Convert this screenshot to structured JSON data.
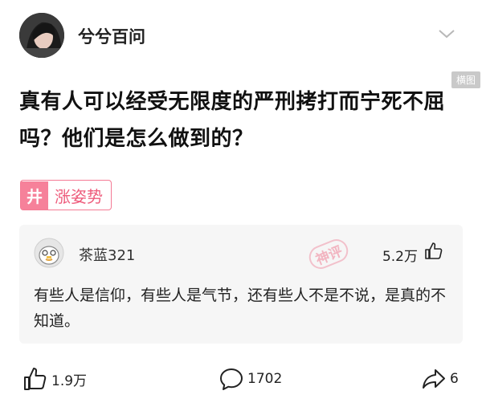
{
  "header": {
    "author_name": "兮兮百问",
    "image_badge": "横图"
  },
  "question": {
    "title": "真有人可以经受无限度的严刑拷打而宁死不屈吗？他们是怎么做到的？"
  },
  "tag": {
    "icon_glyph": "井",
    "label": "涨姿势"
  },
  "answer": {
    "user_name": "茶蓝321",
    "likes": "5.2万",
    "text": "有些人是信仰，有些人是气节，还有些人不是不说，是真的不知道。",
    "watermark": "神评"
  },
  "footer": {
    "likes_count": "1.9万",
    "comments_count": "1702",
    "shares_count": "6"
  },
  "colors": {
    "accent_pink": "#f6819a",
    "tag_text": "#ee5c7c",
    "card_bg": "#f6f6f6"
  }
}
